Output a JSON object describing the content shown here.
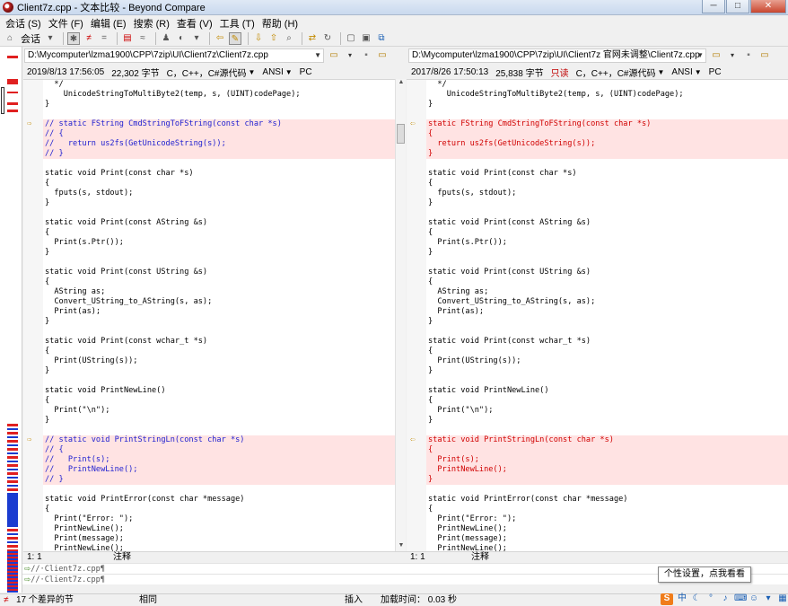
{
  "window": {
    "title": "Client7z.cpp - 文本比较 - Beyond Compare"
  },
  "menu": [
    "会话 (S)",
    "文件 (F)",
    "编辑 (E)",
    "搜索 (R)",
    "查看 (V)",
    "工具 (T)",
    "帮助 (H)"
  ],
  "toolbar": {
    "session_label": "会话"
  },
  "left": {
    "path": "D:\\Mycomputer\\lzma1900\\CPP\\7zip\\UI\\Client7z\\Client7z.cpp",
    "date": "2019/8/13 17:56:05",
    "size": "22,302 字节",
    "lang": "C，C++，C#源代码",
    "encoding": "ANSI",
    "eol": "PC",
    "pos": "1: 1",
    "kind": "注释"
  },
  "right": {
    "path": "D:\\Mycomputer\\lzma1900\\CPP\\7zip\\UI\\Client7z 官网未调整\\Client7z.cpp",
    "date": "2017/8/26 17:50:13",
    "size": "25,838 字节",
    "readonly": "只读",
    "lang": "C，C++，C#源代码",
    "encoding": "ANSI",
    "eol": "PC",
    "pos": "1: 1",
    "kind": "注释"
  },
  "code_left": [
    "  */",
    "    UnicodeStringToMultiByte2(temp, s, (UINT)codePage);",
    "}",
    "",
    "// static FString CmdStringToFString(const char *s)",
    "// {",
    "//   return us2fs(GetUnicodeString(s));",
    "// }",
    "",
    "static void Print(const char *s)",
    "{",
    "  fputs(s, stdout);",
    "}",
    "",
    "static void Print(const AString &s)",
    "{",
    "  Print(s.Ptr());",
    "}",
    "",
    "static void Print(const UString &s)",
    "{",
    "  AString as;",
    "  Convert_UString_to_AString(s, as);",
    "  Print(as);",
    "}",
    "",
    "static void Print(const wchar_t *s)",
    "{",
    "  Print(UString(s));",
    "}",
    "",
    "static void PrintNewLine()",
    "{",
    "  Print(\"\\n\");",
    "}",
    "",
    "// static void PrintStringLn(const char *s)",
    "// {",
    "//   Print(s);",
    "//   PrintNewLine();",
    "// }",
    "",
    "static void PrintError(const char *message)",
    "{",
    "  Print(\"Error: \");",
    "  PrintNewLine();",
    "  Print(message);",
    "  PrintNewLine();"
  ],
  "code_right": [
    "  */",
    "    UnicodeStringToMultiByte2(temp, s, (UINT)codePage);",
    "}",
    "",
    "static FString CmdStringToFString(const char *s)",
    "{",
    "  return us2fs(GetUnicodeString(s));",
    "}",
    "",
    "static void Print(const char *s)",
    "{",
    "  fputs(s, stdout);",
    "}",
    "",
    "static void Print(const AString &s)",
    "{",
    "  Print(s.Ptr());",
    "}",
    "",
    "static void Print(const UString &s)",
    "{",
    "  AString as;",
    "  Convert_UString_to_AString(s, as);",
    "  Print(as);",
    "}",
    "",
    "static void Print(const wchar_t *s)",
    "{",
    "  Print(UString(s));",
    "}",
    "",
    "static void PrintNewLine()",
    "{",
    "  Print(\"\\n\");",
    "}",
    "",
    "static void PrintStringLn(const char *s)",
    "{",
    "  Print(s);",
    "  PrintNewLine();",
    "}",
    "",
    "static void PrintError(const char *message)",
    "{",
    "  Print(\"Error: \");",
    "  PrintNewLine();",
    "  Print(message);",
    "  PrintNewLine();"
  ],
  "detail_lines": [
    "//·Client7z.cpp¶",
    "//·Client7z.cpp¶"
  ],
  "status": {
    "diff_count": "17 个差异的节",
    "same": "相同",
    "insert": "插入",
    "load_time": "加载时间： 0.03 秒"
  },
  "tooltip": "个性设置，点我看看",
  "tray": {
    "ime": "中"
  }
}
